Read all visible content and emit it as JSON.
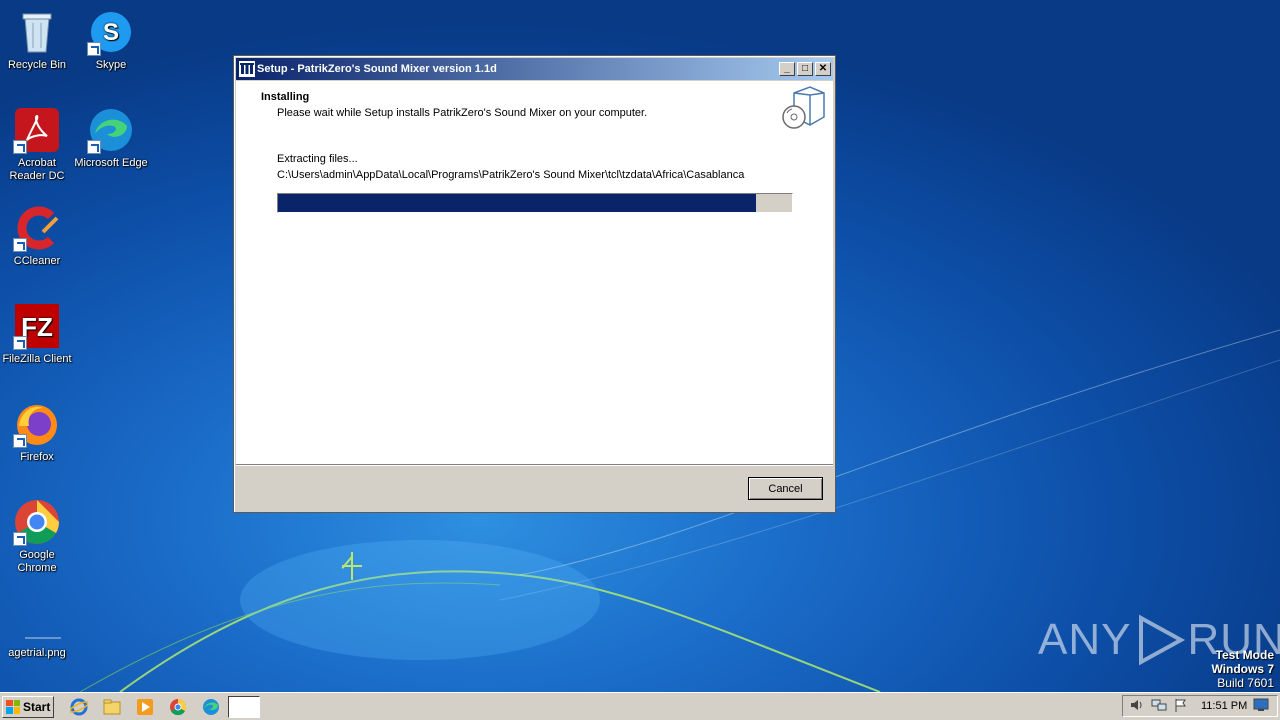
{
  "desktop": {
    "icons": [
      {
        "label": "Recycle Bin"
      },
      {
        "label": "Skype"
      },
      {
        "label": "Acrobat Reader DC"
      },
      {
        "label": "Microsoft Edge"
      },
      {
        "label": "CCleaner"
      },
      {
        "label": "FileZilla Client"
      },
      {
        "label": "Firefox"
      },
      {
        "label": "Google Chrome"
      },
      {
        "label": "agetrial.png"
      }
    ]
  },
  "window": {
    "title": "Setup - PatrikZero's Sound Mixer version 1.1d",
    "controls": {
      "minimize": "_",
      "maximize": "□",
      "close": "✕"
    },
    "header_title": "Installing",
    "header_subtitle": "Please wait while Setup installs PatrikZero's Sound Mixer on your computer.",
    "status_label": "Extracting files...",
    "status_path": "C:\\Users\\admin\\AppData\\Local\\Programs\\PatrikZero's Sound Mixer\\tcl\\tzdata\\Africa\\Casablanca",
    "progress_percent": 93,
    "cancel_label": "Cancel"
  },
  "watermark": {
    "text_left": "ANY",
    "text_right": "RUN"
  },
  "test_mode": {
    "line1": "Test Mode",
    "line2": "Windows 7",
    "line3": "Build 7601"
  },
  "taskbar": {
    "start_label": "Start",
    "clock": "11:51 PM"
  }
}
